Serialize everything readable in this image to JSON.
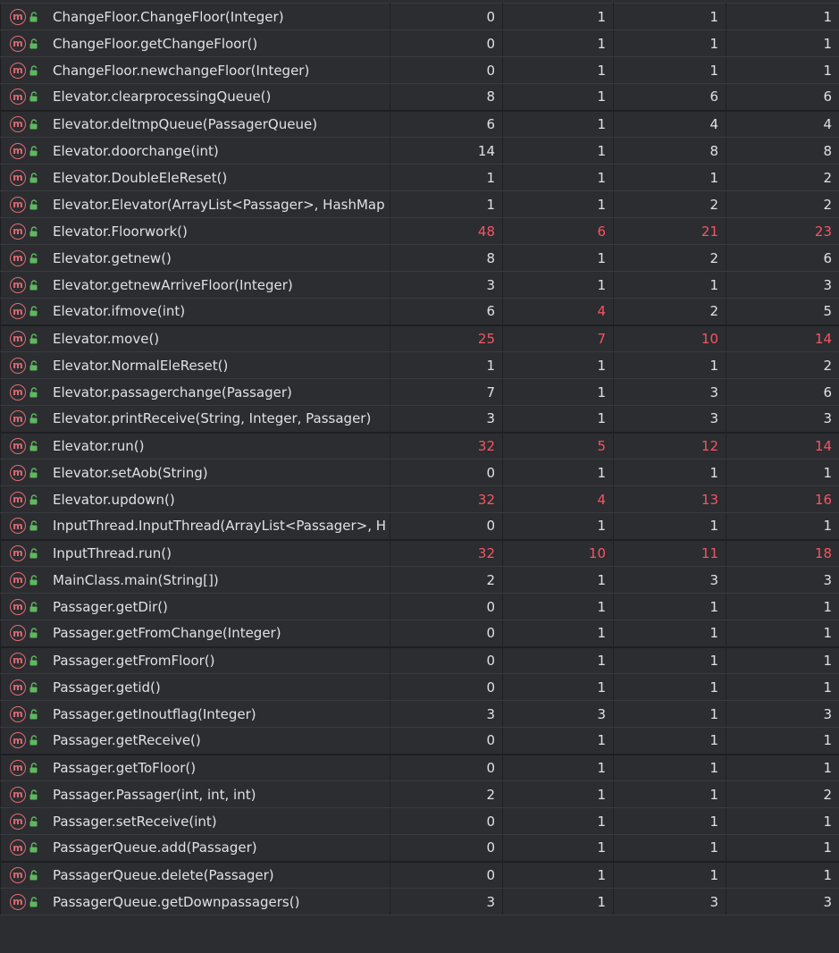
{
  "icons": {
    "method": "method-icon",
    "access": "public-lock-icon"
  },
  "colors": {
    "background": "#2b2d30",
    "text": "#dfe1e5",
    "highlight": "#f75464",
    "method_icon": "#e06c75",
    "lock_icon": "#5fb85f"
  },
  "rows": [
    {
      "name": "ChangeFloor.ChangeFloor(Integer)",
      "values": [
        "0",
        "1",
        "1",
        "1"
      ],
      "hl": [
        false,
        false,
        false,
        false
      ],
      "group_start": false
    },
    {
      "name": "ChangeFloor.getChangeFloor()",
      "values": [
        "0",
        "1",
        "1",
        "1"
      ],
      "hl": [
        false,
        false,
        false,
        false
      ],
      "group_start": false
    },
    {
      "name": "ChangeFloor.newchangeFloor(Integer)",
      "values": [
        "0",
        "1",
        "1",
        "1"
      ],
      "hl": [
        false,
        false,
        false,
        false
      ],
      "group_start": false
    },
    {
      "name": "Elevator.clearprocessingQueue()",
      "values": [
        "8",
        "1",
        "6",
        "6"
      ],
      "hl": [
        false,
        false,
        false,
        false
      ],
      "group_start": false
    },
    {
      "name": "Elevator.deltmpQueue(PassagerQueue)",
      "values": [
        "6",
        "1",
        "4",
        "4"
      ],
      "hl": [
        false,
        false,
        false,
        false
      ],
      "group_start": true
    },
    {
      "name": "Elevator.doorchange(int)",
      "values": [
        "14",
        "1",
        "8",
        "8"
      ],
      "hl": [
        false,
        false,
        false,
        false
      ],
      "group_start": false
    },
    {
      "name": "Elevator.DoubleEleReset()",
      "values": [
        "1",
        "1",
        "1",
        "2"
      ],
      "hl": [
        false,
        false,
        false,
        false
      ],
      "group_start": false
    },
    {
      "name": "Elevator.Elevator(ArrayList<Passager>, HashMap",
      "values": [
        "1",
        "1",
        "2",
        "2"
      ],
      "hl": [
        false,
        false,
        false,
        false
      ],
      "group_start": false
    },
    {
      "name": "Elevator.Floorwork()",
      "values": [
        "48",
        "6",
        "21",
        "23"
      ],
      "hl": [
        true,
        true,
        true,
        true
      ],
      "group_start": false
    },
    {
      "name": "Elevator.getnew()",
      "values": [
        "8",
        "1",
        "2",
        "6"
      ],
      "hl": [
        false,
        false,
        false,
        false
      ],
      "group_start": false
    },
    {
      "name": "Elevator.getnewArriveFloor(Integer)",
      "values": [
        "3",
        "1",
        "1",
        "3"
      ],
      "hl": [
        false,
        false,
        false,
        false
      ],
      "group_start": false
    },
    {
      "name": "Elevator.ifmove(int)",
      "values": [
        "6",
        "4",
        "2",
        "5"
      ],
      "hl": [
        false,
        true,
        false,
        false
      ],
      "group_start": false
    },
    {
      "name": "Elevator.move()",
      "values": [
        "25",
        "7",
        "10",
        "14"
      ],
      "hl": [
        true,
        true,
        true,
        true
      ],
      "group_start": true
    },
    {
      "name": "Elevator.NormalEleReset()",
      "values": [
        "1",
        "1",
        "1",
        "2"
      ],
      "hl": [
        false,
        false,
        false,
        false
      ],
      "group_start": false
    },
    {
      "name": "Elevator.passagerchange(Passager)",
      "values": [
        "7",
        "1",
        "3",
        "6"
      ],
      "hl": [
        false,
        false,
        false,
        false
      ],
      "group_start": false
    },
    {
      "name": "Elevator.printReceive(String, Integer, Passager)",
      "values": [
        "3",
        "1",
        "3",
        "3"
      ],
      "hl": [
        false,
        false,
        false,
        false
      ],
      "group_start": false
    },
    {
      "name": "Elevator.run()",
      "values": [
        "32",
        "5",
        "12",
        "14"
      ],
      "hl": [
        true,
        true,
        true,
        true
      ],
      "group_start": true
    },
    {
      "name": "Elevator.setAob(String)",
      "values": [
        "0",
        "1",
        "1",
        "1"
      ],
      "hl": [
        false,
        false,
        false,
        false
      ],
      "group_start": false
    },
    {
      "name": "Elevator.updown()",
      "values": [
        "32",
        "4",
        "13",
        "16"
      ],
      "hl": [
        true,
        true,
        true,
        true
      ],
      "group_start": false
    },
    {
      "name": "InputThread.InputThread(ArrayList<Passager>, H",
      "values": [
        "0",
        "1",
        "1",
        "1"
      ],
      "hl": [
        false,
        false,
        false,
        false
      ],
      "group_start": false
    },
    {
      "name": "InputThread.run()",
      "values": [
        "32",
        "10",
        "11",
        "18"
      ],
      "hl": [
        true,
        true,
        true,
        true
      ],
      "group_start": true
    },
    {
      "name": "MainClass.main(String[])",
      "values": [
        "2",
        "1",
        "3",
        "3"
      ],
      "hl": [
        false,
        false,
        false,
        false
      ],
      "group_start": false
    },
    {
      "name": "Passager.getDir()",
      "values": [
        "0",
        "1",
        "1",
        "1"
      ],
      "hl": [
        false,
        false,
        false,
        false
      ],
      "group_start": false
    },
    {
      "name": "Passager.getFromChange(Integer)",
      "values": [
        "0",
        "1",
        "1",
        "1"
      ],
      "hl": [
        false,
        false,
        false,
        false
      ],
      "group_start": false
    },
    {
      "name": "Passager.getFromFloor()",
      "values": [
        "0",
        "1",
        "1",
        "1"
      ],
      "hl": [
        false,
        false,
        false,
        false
      ],
      "group_start": true
    },
    {
      "name": "Passager.getid()",
      "values": [
        "0",
        "1",
        "1",
        "1"
      ],
      "hl": [
        false,
        false,
        false,
        false
      ],
      "group_start": false
    },
    {
      "name": "Passager.getInoutflag(Integer)",
      "values": [
        "3",
        "3",
        "1",
        "3"
      ],
      "hl": [
        false,
        false,
        false,
        false
      ],
      "group_start": false
    },
    {
      "name": "Passager.getReceive()",
      "values": [
        "0",
        "1",
        "1",
        "1"
      ],
      "hl": [
        false,
        false,
        false,
        false
      ],
      "group_start": false
    },
    {
      "name": "Passager.getToFloor()",
      "values": [
        "0",
        "1",
        "1",
        "1"
      ],
      "hl": [
        false,
        false,
        false,
        false
      ],
      "group_start": true
    },
    {
      "name": "Passager.Passager(int, int, int)",
      "values": [
        "2",
        "1",
        "1",
        "2"
      ],
      "hl": [
        false,
        false,
        false,
        false
      ],
      "group_start": false
    },
    {
      "name": "Passager.setReceive(int)",
      "values": [
        "0",
        "1",
        "1",
        "1"
      ],
      "hl": [
        false,
        false,
        false,
        false
      ],
      "group_start": false
    },
    {
      "name": "PassagerQueue.add(Passager)",
      "values": [
        "0",
        "1",
        "1",
        "1"
      ],
      "hl": [
        false,
        false,
        false,
        false
      ],
      "group_start": false
    },
    {
      "name": "PassagerQueue.delete(Passager)",
      "values": [
        "0",
        "1",
        "1",
        "1"
      ],
      "hl": [
        false,
        false,
        false,
        false
      ],
      "group_start": true
    },
    {
      "name": "PassagerQueue.getDownpassagers()",
      "values": [
        "3",
        "1",
        "3",
        "3"
      ],
      "hl": [
        false,
        false,
        false,
        false
      ],
      "group_start": false
    }
  ]
}
